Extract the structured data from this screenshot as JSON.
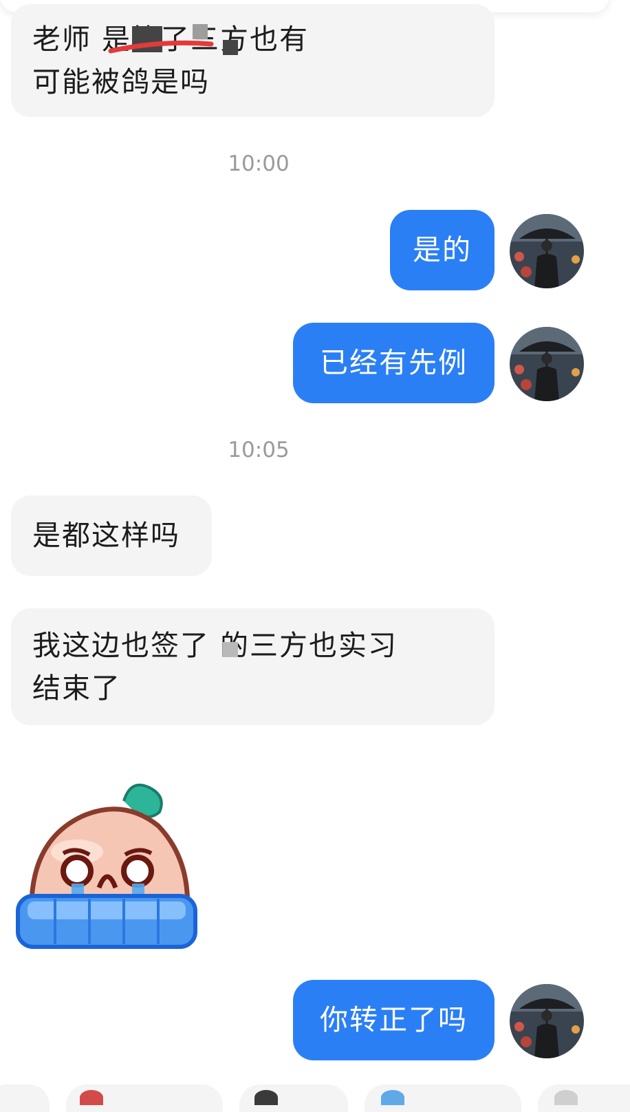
{
  "messages": {
    "m1_line1": "老师 是签了三方也有",
    "m1_line2": "可能被鸽是吗",
    "t1": "10:00",
    "m2": "是的",
    "m3": "已经有先例",
    "t2": "10:05",
    "m4": "是都这样吗",
    "m5_line1": "我这边也签了 的三方也实习",
    "m5_line2": "结束了",
    "m6": "你转正了吗"
  },
  "colors": {
    "sent_bubble": "#2b7ff4",
    "received_bubble": "#f4f4f4",
    "timestamp": "#9a9a9a"
  },
  "icons": {
    "avatar": "man-with-umbrella-avatar",
    "sticker": "crying-peach-sticker"
  }
}
